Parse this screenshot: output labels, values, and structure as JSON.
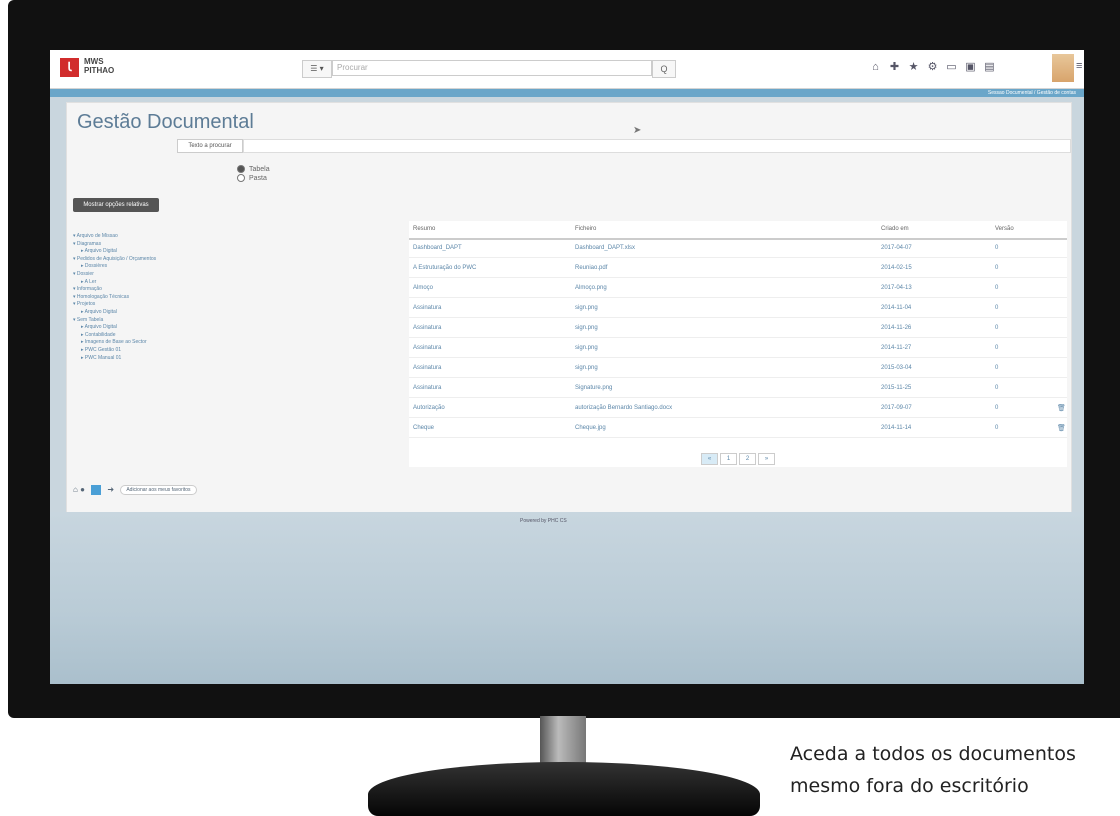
{
  "app": {
    "logo_mark": "Ꙇ",
    "logo_line1": "MWS",
    "logo_line2": "PITHAO",
    "menu_label": "☰ ▾",
    "search_placeholder": "Procurar",
    "search_icon": "Q",
    "top_icons": [
      "home-icon",
      "plus-icon",
      "star-icon",
      "gear-icon",
      "calendar-icon",
      "laptop-icon",
      "monitor-icon"
    ],
    "breadcrumb": "Sessao Documental / Gestão de contas"
  },
  "page": {
    "title": "Gestão Documental",
    "search_label": "Texto a procurar",
    "view_options": [
      "Tabela",
      "Pasta"
    ],
    "selected_view": "Tabela",
    "options_button": "Mostrar opções relativas",
    "bottom_pill": "Adicionar aos meus favoritos"
  },
  "tree": [
    {
      "label": "Arquivo de Missao",
      "level": 1
    },
    {
      "label": "Diagramas",
      "level": 1
    },
    {
      "label": "Arquivo Digital",
      "level": 2
    },
    {
      "label": "Pedidos de Aquisição / Orçamentos",
      "level": 1
    },
    {
      "label": "Dossières",
      "level": 2
    },
    {
      "label": "Dossier",
      "level": 1
    },
    {
      "label": "A Ler",
      "level": 2
    },
    {
      "label": "Informação",
      "level": 1
    },
    {
      "label": "Homologação Técnicas",
      "level": 1
    },
    {
      "label": "Projetos",
      "level": 1
    },
    {
      "label": "Arquivo Digital",
      "level": 2
    },
    {
      "label": "Sem Tabela",
      "level": 1
    },
    {
      "label": "Arquivo Digital",
      "level": 2
    },
    {
      "label": "Contabilidade",
      "level": 2
    },
    {
      "label": "Imagens de Base ao Sector",
      "level": 2
    },
    {
      "label": "PWC Gestão 01",
      "level": 2
    },
    {
      "label": "PWC Manual 01",
      "level": 2
    }
  ],
  "table": {
    "headers": [
      "Resumo",
      "Ficheiro",
      "Criado em",
      "Versão"
    ],
    "rows": [
      {
        "resumo": "Dashboard_DAPT",
        "ficheiro": "Dashboard_DAPT.xlsx",
        "criado": "2017-04-07",
        "versao": "0",
        "trash": false
      },
      {
        "resumo": "A Estruturação do PWC",
        "ficheiro": "Reuniao.pdf",
        "criado": "2014-02-15",
        "versao": "0",
        "trash": false
      },
      {
        "resumo": "Almoço",
        "ficheiro": "Almoço.png",
        "criado": "2017-04-13",
        "versao": "0",
        "trash": false
      },
      {
        "resumo": "Assinatura",
        "ficheiro": "sign.png",
        "criado": "2014-11-04",
        "versao": "0",
        "trash": false
      },
      {
        "resumo": "Assinatura",
        "ficheiro": "sign.png",
        "criado": "2014-11-26",
        "versao": "0",
        "trash": false
      },
      {
        "resumo": "Assinatura",
        "ficheiro": "sign.png",
        "criado": "2014-11-27",
        "versao": "0",
        "trash": false
      },
      {
        "resumo": "Assinatura",
        "ficheiro": "sign.png",
        "criado": "2015-03-04",
        "versao": "0",
        "trash": false
      },
      {
        "resumo": "Assinatura",
        "ficheiro": "Signature.png",
        "criado": "2015-11-25",
        "versao": "0",
        "trash": false
      },
      {
        "resumo": "Autorização",
        "ficheiro": "autorização Bernardo Santiago.docx",
        "criado": "2017-09-07",
        "versao": "0",
        "trash": true
      },
      {
        "resumo": "Cheque",
        "ficheiro": "Cheque.jpg",
        "criado": "2014-11-14",
        "versao": "0",
        "trash": true
      }
    ],
    "pager": [
      "«",
      "1",
      "2",
      "»"
    ]
  },
  "footer": "Powered by PHC CS",
  "caption": {
    "line1": "Aceda a todos os documentos",
    "line2": "mesmo fora do escritório"
  }
}
